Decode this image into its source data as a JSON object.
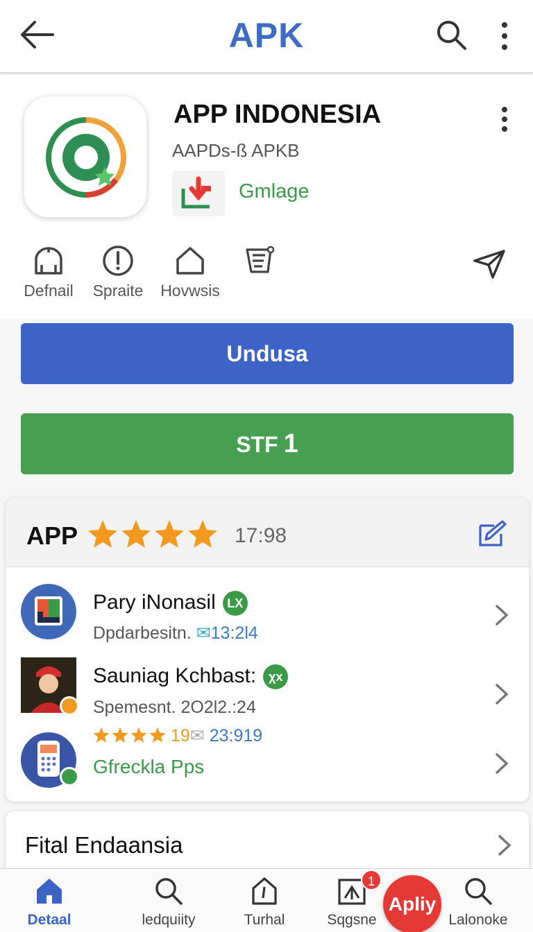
{
  "topbar": {
    "title": "APK",
    "back_icon": "arrow-left-icon",
    "search_icon": "search-icon",
    "more_icon": "more-vert-icon"
  },
  "app": {
    "name": "APP INDONESIA",
    "subtitle": "AAPDs-ß APKB",
    "badge_label": "Gmlage",
    "icon": "app-logo-icon"
  },
  "actions": [
    {
      "label": "Defnail",
      "icon": "store-icon"
    },
    {
      "label": "Spraite",
      "icon": "alert-circle-icon"
    },
    {
      "label": "Hovwsis",
      "icon": "home-icon"
    },
    {
      "label": "",
      "icon": "receipt-icon"
    }
  ],
  "share_icon": "send-icon",
  "buttons": {
    "primary_label": "Undusa",
    "secondary_label": "STF",
    "secondary_number": "1"
  },
  "review": {
    "header_label": "APP",
    "rating": 4,
    "time": "17:98",
    "edit_icon": "edit-icon",
    "items": [
      {
        "name": "Pary iNonasil",
        "pill": "LX",
        "sub": "Dpdarbesitn.",
        "meta": "13:2l4"
      },
      {
        "name": "Sauniag Kchbast:",
        "pill": "χx",
        "sub": "Spemesnt. 2O2l2.:24",
        "rating_text": "19",
        "meta": "23:919"
      },
      {
        "name": "Gfreckla Pps"
      }
    ]
  },
  "section": {
    "title": "Fital Endaansia"
  },
  "colors": {
    "brand_blue": "#3d63c7",
    "brand_green": "#47a052",
    "accent_red": "#e53935",
    "star": "#f29a1f"
  },
  "bottomnav": [
    {
      "label": "Detaal",
      "icon": "home-icon",
      "active": true
    },
    {
      "label": "ledquiity",
      "icon": "search-icon"
    },
    {
      "label": "Turhal",
      "icon": "home-outline-icon"
    },
    {
      "label": "Sqgsne",
      "icon": "chart-box-icon"
    },
    {
      "label": "Lalonoke",
      "icon": "search-icon"
    }
  ],
  "notification_count": "1",
  "fab_label": "Apliy"
}
